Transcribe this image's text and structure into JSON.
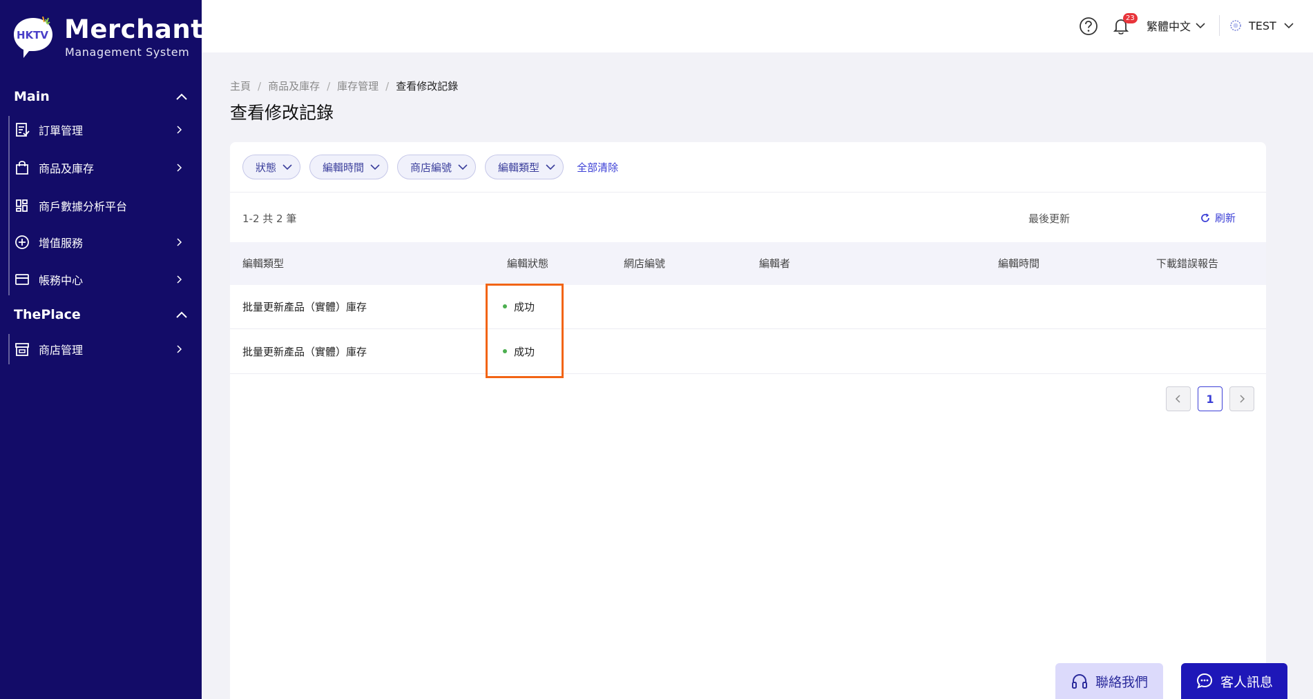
{
  "brand": {
    "logo_text": "HKTV",
    "title": "Merchant",
    "subtitle": "Management System"
  },
  "sidebar": {
    "sections": [
      {
        "title": "Main",
        "items": [
          {
            "label": "訂單管理",
            "icon": "order-icon"
          },
          {
            "label": "商品及庫存",
            "icon": "shopping-bag-icon"
          },
          {
            "label": "商戶數據分析平台",
            "icon": "dashboard-icon"
          },
          {
            "label": "增值服務",
            "icon": "plus-circle-icon"
          },
          {
            "label": "帳務中心",
            "icon": "credit-card-icon"
          }
        ]
      },
      {
        "title": "ThePlace",
        "items": [
          {
            "label": "商店管理",
            "icon": "store-icon"
          }
        ]
      }
    ]
  },
  "topbar": {
    "notification_count": "23",
    "language": "繁體中文",
    "user": "TEST"
  },
  "breadcrumb": [
    "主頁",
    "商品及庫存",
    "庫存管理",
    "查看修改記錄"
  ],
  "page_title": "查看修改記錄",
  "filters": {
    "chips": [
      "狀態",
      "編輯時間",
      "商店編號",
      "編輯類型"
    ],
    "clear_all": "全部清除"
  },
  "summary": "1-2 共 2 筆",
  "last_update_label": "最後更新",
  "refresh_label": "刷新",
  "table": {
    "columns": [
      "編輯類型",
      "編輯狀態",
      "網店編號",
      "編輯者",
      "編輯時間",
      "下載錯誤報告"
    ],
    "rows": [
      {
        "type": "批量更新產品（實體）庫存",
        "status": "成功",
        "store": "",
        "editor": "",
        "time": "",
        "report": ""
      },
      {
        "type": "批量更新產品（實體）庫存",
        "status": "成功",
        "store": "",
        "editor": "",
        "time": "",
        "report": ""
      }
    ]
  },
  "pagination": {
    "current_page": "1"
  },
  "buttons": {
    "contact": "聯絡我們",
    "chat": "客人訊息"
  },
  "colors": {
    "sidebar_bg": "#130c68",
    "accent": "#3b3fd6",
    "success": "#4caf50",
    "highlight": "#f26414"
  }
}
